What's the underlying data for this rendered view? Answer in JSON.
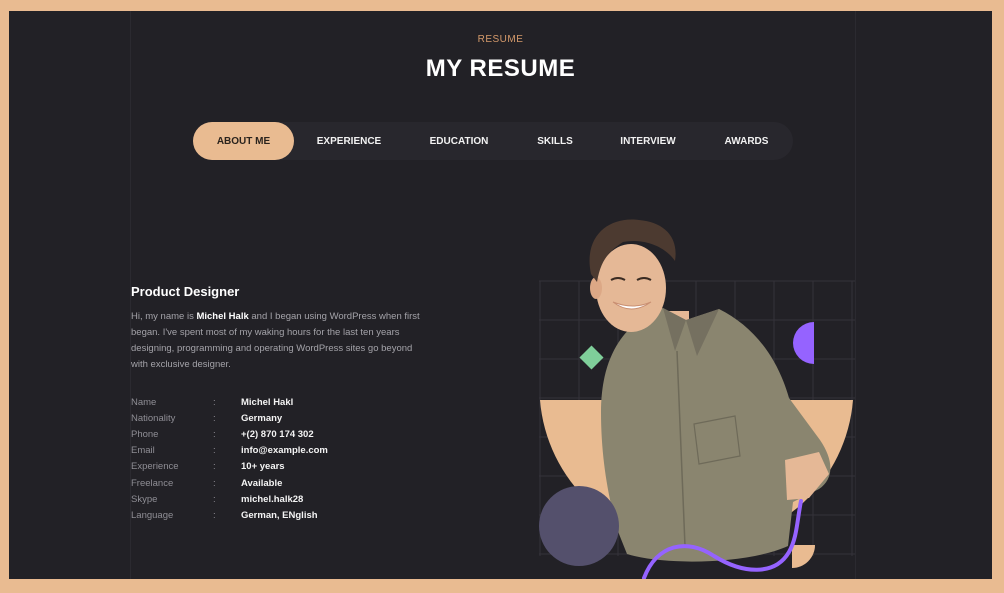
{
  "header": {
    "eyebrow": "RESUME",
    "title": "MY RESUME"
  },
  "tabs": [
    {
      "label": "ABOUT ME",
      "active": true
    },
    {
      "label": "EXPERIENCE"
    },
    {
      "label": "EDUCATION"
    },
    {
      "label": "SKILLS"
    },
    {
      "label": "INTERVIEW"
    },
    {
      "label": "AWARDS"
    }
  ],
  "about": {
    "role": "Product Designer",
    "bio_before": "Hi, my name is ",
    "bio_name": "Michel Halk",
    "bio_after": " and I began using WordPress when first began. I've spent most of my waking hours for the last ten years designing, programming and operating WordPress sites go beyond with exclusive designer.",
    "info": [
      {
        "label": "Name",
        "value": "Michel Hakl"
      },
      {
        "label": "Nationality",
        "value": "Germany"
      },
      {
        "label": "Phone",
        "value": "+(2) 870 174 302"
      },
      {
        "label": "Email",
        "value": "info@example.com"
      },
      {
        "label": "Experience",
        "value": "10+ years"
      },
      {
        "label": "Freelance",
        "value": "Available"
      },
      {
        "label": "Skype",
        "value": "michel.halk28"
      },
      {
        "label": "Language",
        "value": "German, ENglish"
      }
    ]
  },
  "colors": {
    "background": "#222126",
    "accent": "#e9bb91",
    "purple": "#9563ff",
    "green": "#7fcf9a",
    "slate": "#54506c"
  }
}
